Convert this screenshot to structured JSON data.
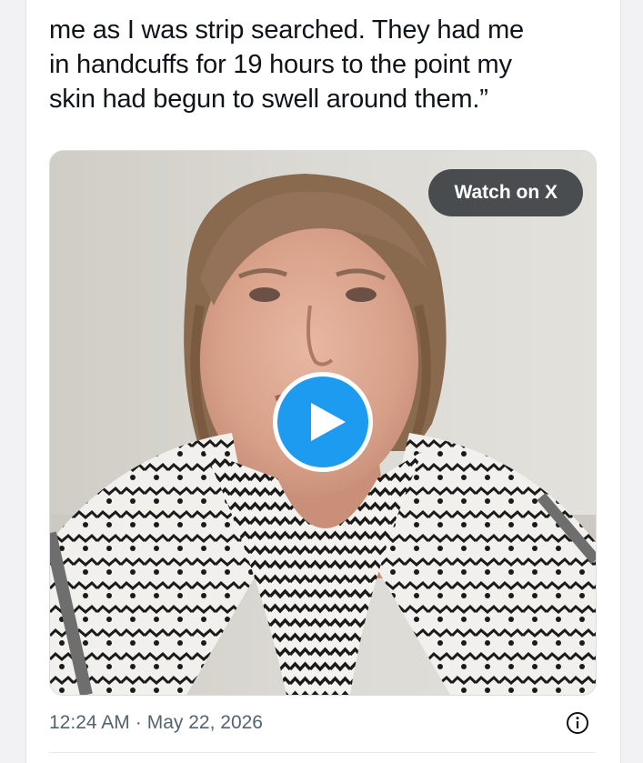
{
  "tweet": {
    "text_lines": [
      "me as I was strip searched. They had me",
      "in handcuffs for 19 hours to the point my",
      "skin had begun to swell around them.”"
    ]
  },
  "media": {
    "watch_label": "Watch on X",
    "play_icon": "play-icon"
  },
  "meta": {
    "time": "12:24 AM",
    "separator": "·",
    "date": "May 22, 2026",
    "info_icon": "info-icon"
  },
  "colors": {
    "accent": "#1d9bf0",
    "text": "#0f1419",
    "secondary": "#536471"
  }
}
